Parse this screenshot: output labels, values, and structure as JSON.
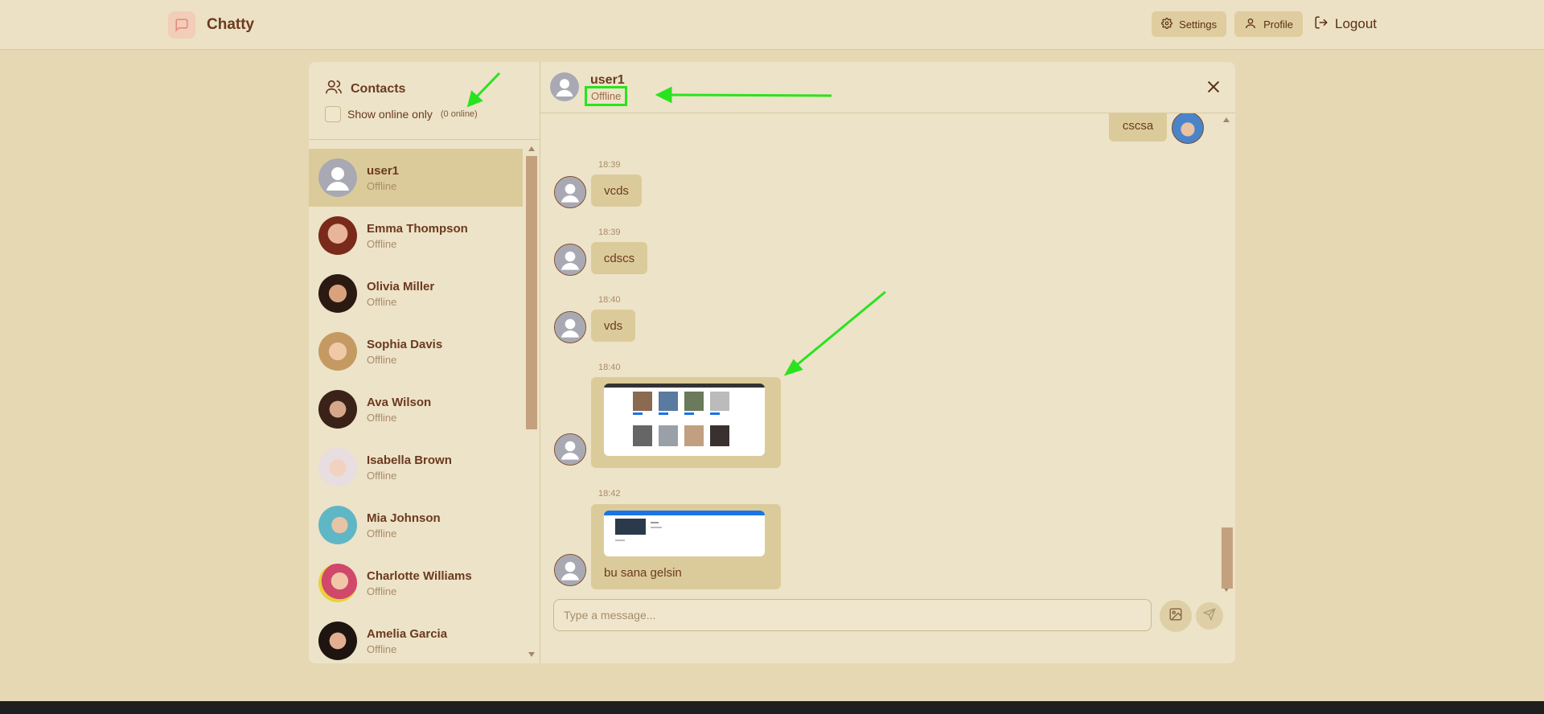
{
  "header": {
    "brand": "Chatty",
    "settings_label": "Settings",
    "profile_label": "Profile",
    "logout_label": "Logout"
  },
  "sidebar": {
    "title": "Contacts",
    "filter_label": "Show online only",
    "online_count": "(0 online)",
    "contacts": [
      {
        "name": "user1",
        "status": "Offline",
        "avatar": "default-avatar"
      },
      {
        "name": "Emma Thompson",
        "status": "Offline",
        "avatar": "photo-avatar"
      },
      {
        "name": "Olivia Miller",
        "status": "Offline",
        "avatar": "photo-avatar"
      },
      {
        "name": "Sophia Davis",
        "status": "Offline",
        "avatar": "photo-avatar"
      },
      {
        "name": "Ava Wilson",
        "status": "Offline",
        "avatar": "photo-avatar"
      },
      {
        "name": "Isabella Brown",
        "status": "Offline",
        "avatar": "photo-avatar"
      },
      {
        "name": "Mia Johnson",
        "status": "Offline",
        "avatar": "photo-avatar"
      },
      {
        "name": "Charlotte Williams",
        "status": "Offline",
        "avatar": "photo-avatar"
      },
      {
        "name": "Amelia Garcia",
        "status": "Offline",
        "avatar": "photo-avatar"
      }
    ]
  },
  "chat": {
    "name": "user1",
    "status": "Offline",
    "messages": [
      {
        "text": "cscsa",
        "time": "",
        "side": "right"
      },
      {
        "text": "vcds",
        "time": "18:39",
        "side": "left"
      },
      {
        "text": "cdscs",
        "time": "18:39",
        "side": "left"
      },
      {
        "text": "vds",
        "time": "18:40",
        "side": "left"
      },
      {
        "text": "",
        "time": "18:40",
        "side": "left",
        "image": "screenshot-image"
      },
      {
        "text": "bu sana gelsin",
        "time": "18:42",
        "side": "left",
        "image": "screenshot-image"
      }
    ],
    "input_placeholder": "Type a message..."
  },
  "colors": {
    "background": "#e5d8b3",
    "accent_bubble": "#dccb9a",
    "text": "#6b3a1f",
    "annotation": "#29e31e"
  }
}
